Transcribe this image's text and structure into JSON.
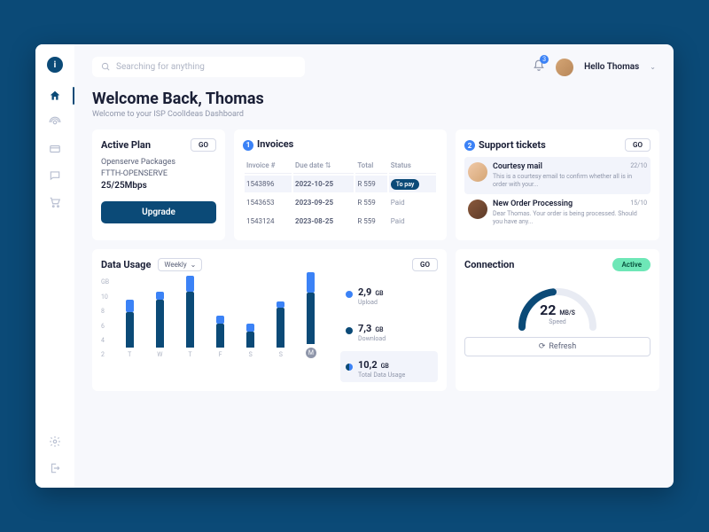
{
  "search": {
    "placeholder": "Searching for anything"
  },
  "notifications": {
    "count": "3"
  },
  "user": {
    "greeting": "Hello Thomas"
  },
  "heading": {
    "title": "Welcome Back, Thomas",
    "subtitle": "Welcome to your ISP CoolIdeas Dashboard"
  },
  "plan": {
    "title": "Active Plan",
    "go": "GO",
    "line1": "Openserve Packages",
    "line2": "FTTH-OPENSERVE",
    "speed": "25/25Mbps",
    "upgrade": "Upgrade"
  },
  "invoices": {
    "badge": "1",
    "title": "Invoices",
    "cols": {
      "num": "Invoice #",
      "due": "Due date",
      "total": "Total",
      "status": "Status"
    },
    "rows": [
      {
        "num": "1543896",
        "due": "2022-10-25",
        "total": "R 559",
        "status": "To pay",
        "pill": true
      },
      {
        "num": "1543653",
        "due": "2023-09-25",
        "total": "R 559",
        "status": "Paid"
      },
      {
        "num": "1543124",
        "due": "2023-08-25",
        "total": "R 559",
        "status": "Paid"
      }
    ]
  },
  "tickets": {
    "badge": "2",
    "title": "Support tickets",
    "go": "GO",
    "items": [
      {
        "title": "Courtesy mail",
        "date": "22/10",
        "desc": "This is a courtesy email to confirm whether all is in order with your..."
      },
      {
        "title": "New Order Processing",
        "date": "15/10",
        "desc": "Dear Thomas. Your order is being processed. Should you have any..."
      }
    ]
  },
  "usage": {
    "title": "Data Usage",
    "period": "Weekly",
    "go": "GO",
    "ylabel": "GB",
    "stats": {
      "upload": {
        "val": "2,9",
        "unit": "GB",
        "label": "Upload"
      },
      "download": {
        "val": "7,3",
        "unit": "GB",
        "label": "Download"
      },
      "total": {
        "val": "10,2",
        "unit": "GB",
        "label": "Total Data Usage"
      }
    }
  },
  "connection": {
    "title": "Connection",
    "status": "Active",
    "speed_val": "22",
    "speed_unit": "MB/S",
    "speed_label": "Speed",
    "refresh": "Refresh"
  },
  "chart_data": {
    "type": "bar",
    "categories": [
      "T",
      "W",
      "T",
      "F",
      "S",
      "S",
      "M"
    ],
    "series": [
      {
        "name": "Download",
        "values": [
          4.5,
          6.0,
          7.0,
          3.0,
          2.0,
          5.0,
          6.5
        ]
      },
      {
        "name": "Upload",
        "values": [
          1.5,
          1.0,
          2.0,
          1.0,
          1.0,
          0.8,
          2.5
        ]
      }
    ],
    "ylabel": "GB",
    "yticks": [
      2,
      4,
      6,
      8,
      10
    ],
    "ylim": [
      0,
      10
    ],
    "active_index": 6
  }
}
